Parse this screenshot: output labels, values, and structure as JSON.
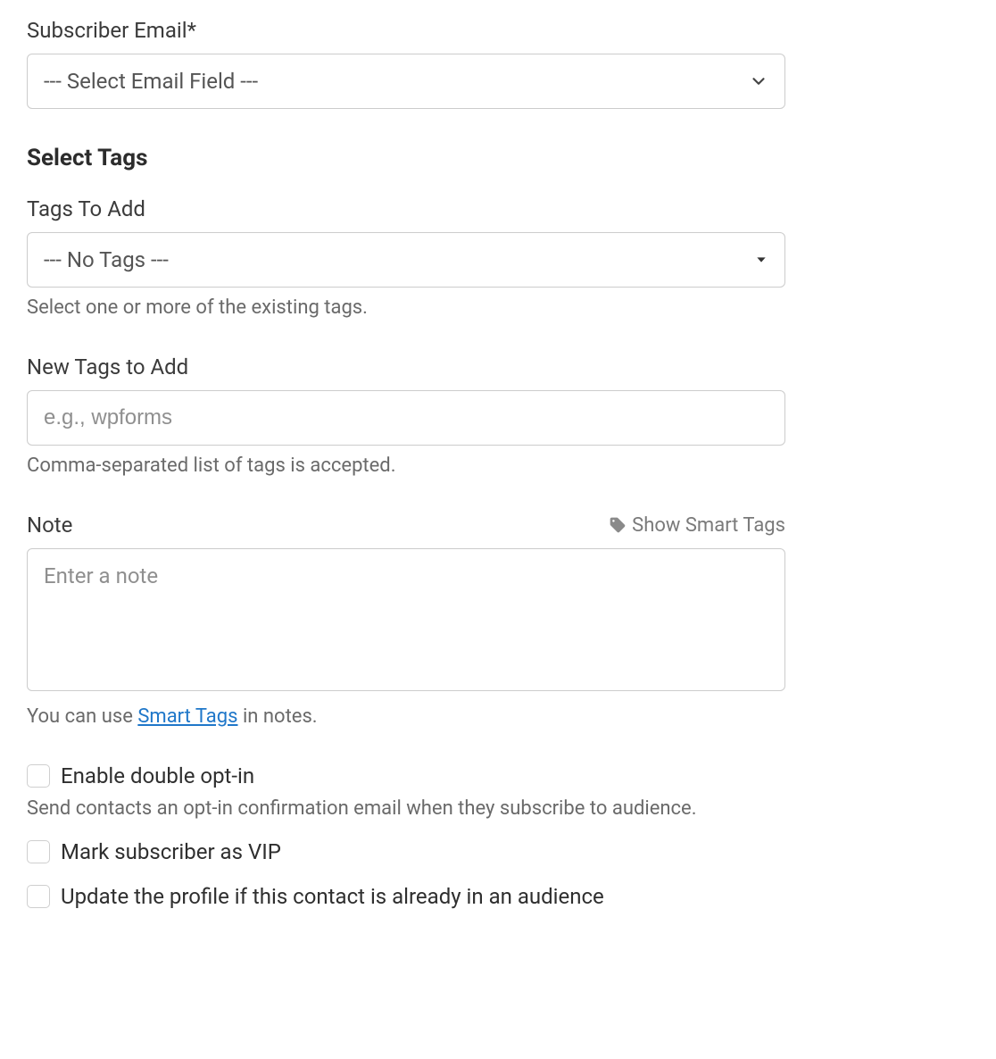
{
  "subscriber_email": {
    "label": "Subscriber Email*",
    "selected": "--- Select Email Field ---"
  },
  "select_tags_heading": "Select Tags",
  "tags_to_add": {
    "label": "Tags To Add",
    "selected": "--- No Tags ---",
    "help": "Select one or more of the existing tags."
  },
  "new_tags": {
    "label": "New Tags to Add",
    "placeholder": "e.g., wpforms",
    "help": "Comma-separated list of tags is accepted."
  },
  "note": {
    "label": "Note",
    "smart_tags_toggle": "Show Smart Tags",
    "placeholder": "Enter a note",
    "help_prefix": "You can use ",
    "help_link": "Smart Tags",
    "help_suffix": " in notes."
  },
  "double_optin": {
    "label": "Enable double opt-in",
    "help": "Send contacts an opt-in confirmation email when they subscribe to audience."
  },
  "mark_vip": {
    "label": "Mark subscriber as VIP"
  },
  "update_profile": {
    "label": "Update the profile if this contact is already in an audience"
  }
}
